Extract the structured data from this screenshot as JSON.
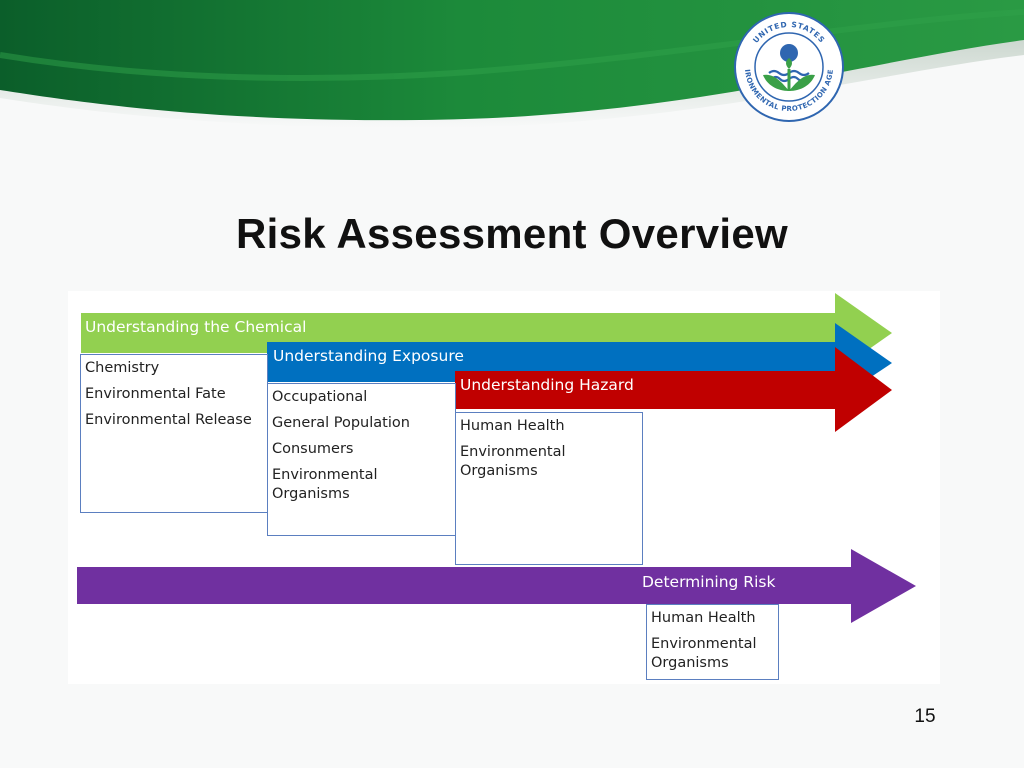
{
  "slide": {
    "title": "Risk Assessment Overview",
    "page_number": "15"
  },
  "logo": {
    "top_text": "UNITED STATES",
    "ring_text": "ENVIRONMENTAL PROTECTION AGENCY",
    "icon": "epa-seal-icon"
  },
  "stages": [
    {
      "label": "Understanding the Chemical",
      "color": "#92d050",
      "items": [
        "Chemistry",
        "Environmental Fate",
        "Environmental Release"
      ]
    },
    {
      "label": "Understanding Exposure",
      "color": "#0070c0",
      "items": [
        "Occupational",
        "General Population",
        "Consumers",
        "Environmental Organisms"
      ]
    },
    {
      "label": "Understanding Hazard",
      "color": "#c00000",
      "items": [
        "Human Health",
        "Environmental Organisms"
      ]
    }
  ],
  "determining_risk": {
    "label": "Determining Risk",
    "color": "#7030a0",
    "items": [
      "Human Health",
      "Environmental Organisms"
    ]
  },
  "colors": {
    "header_green_dark": "#0c6a2e",
    "header_green_light": "#22903c",
    "box_border": "#5b7fc0"
  }
}
